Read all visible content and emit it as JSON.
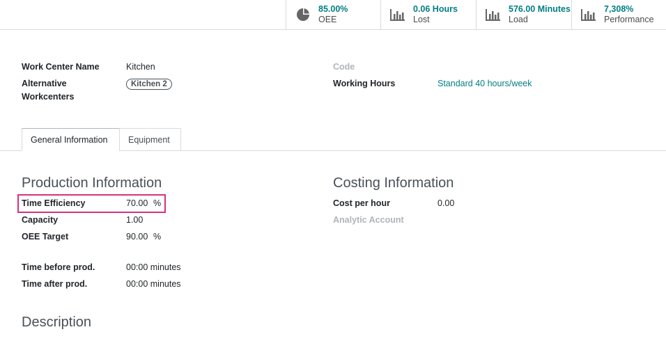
{
  "smart_buttons": [
    {
      "value": "85.00%",
      "label": "OEE",
      "icon": "pie-chart-icon"
    },
    {
      "value": "0.06 Hours",
      "label": "Lost",
      "icon": "bar-chart-icon"
    },
    {
      "value": "576.00 Minutes",
      "label": "Load",
      "icon": "bar-chart-icon"
    },
    {
      "value": "7,308%",
      "label": "Performance",
      "icon": "bar-chart-icon"
    }
  ],
  "header": {
    "work_center_name_label": "Work Center Name",
    "work_center_name_value": "Kitchen",
    "alternative_label_line1": "Alternative",
    "alternative_label_line2": "Workcenters",
    "alternative_tag": "Kitchen 2",
    "code_label": "Code",
    "working_hours_label": "Working Hours",
    "working_hours_value": "Standard 40 hours/week"
  },
  "tabs": [
    {
      "label": "General Information",
      "active": true
    },
    {
      "label": "Equipment",
      "active": false
    }
  ],
  "production": {
    "title": "Production Information",
    "time_efficiency_label": "Time Efficiency",
    "time_efficiency_value": "70.00",
    "time_efficiency_unit": "%",
    "capacity_label": "Capacity",
    "capacity_value": "1.00",
    "oee_target_label": "OEE Target",
    "oee_target_value": "90.00",
    "oee_target_unit": "%",
    "time_before_label": "Time before prod.",
    "time_before_value": "00:00 minutes",
    "time_after_label": "Time after prod.",
    "time_after_value": "00:00 minutes"
  },
  "costing": {
    "title": "Costing Information",
    "cost_per_hour_label": "Cost per hour",
    "cost_per_hour_value": "0.00",
    "analytic_account_label": "Analytic Account"
  },
  "description": {
    "title": "Description"
  },
  "colors": {
    "link": "#017e84",
    "highlight": "#d6317a"
  }
}
